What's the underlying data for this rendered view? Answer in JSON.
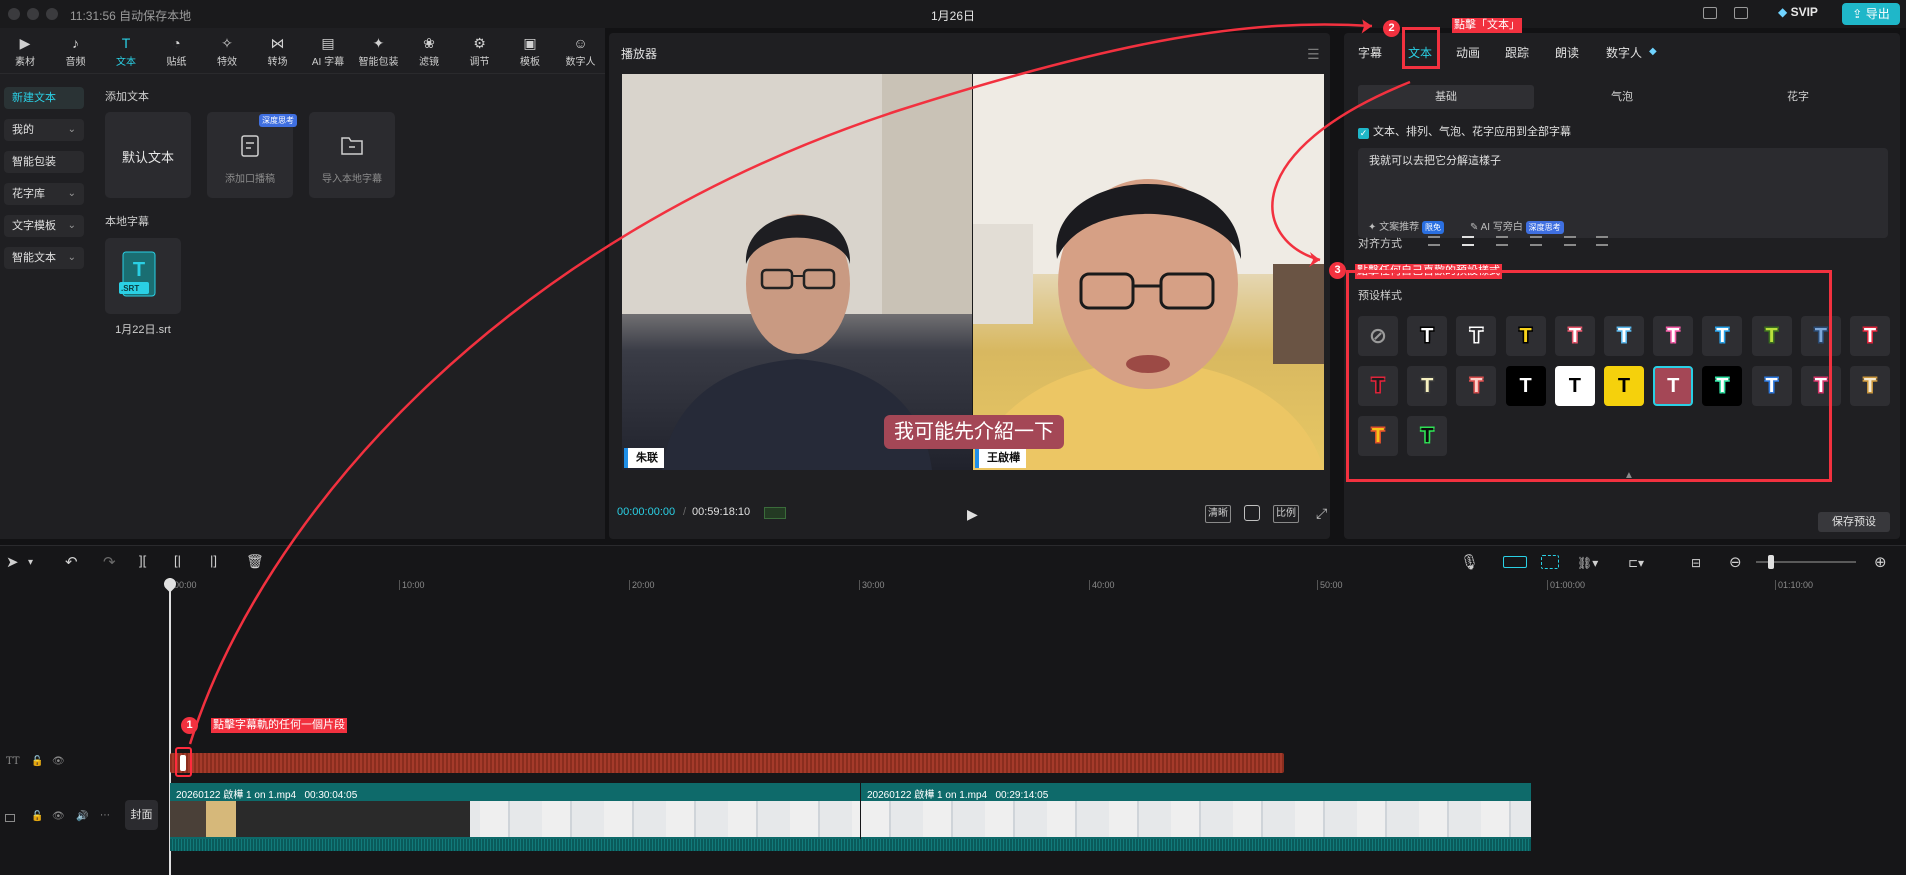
{
  "window": {
    "save_status": "11:31:56 自动保存本地",
    "project_title": "1月26日",
    "svip_label": "SVIP",
    "export_label": "导出"
  },
  "toolbar": {
    "items": [
      {
        "label": "素材",
        "icon": "media-icon"
      },
      {
        "label": "音频",
        "icon": "audio-icon"
      },
      {
        "label": "文本",
        "icon": "text-icon"
      },
      {
        "label": "贴纸",
        "icon": "sticker-icon"
      },
      {
        "label": "特效",
        "icon": "effects-icon"
      },
      {
        "label": "转场",
        "icon": "transition-icon"
      },
      {
        "label": "AI 字幕",
        "icon": "ai-subtitle-icon"
      },
      {
        "label": "智能包装",
        "icon": "smart-pack-icon"
      },
      {
        "label": "滤镜",
        "icon": "filter-icon"
      },
      {
        "label": "调节",
        "icon": "adjust-icon"
      },
      {
        "label": "模板",
        "icon": "template-icon"
      },
      {
        "label": "数字人",
        "icon": "digital-human-icon"
      }
    ],
    "active": "文本"
  },
  "sidebar": {
    "items": [
      {
        "label": "新建文本"
      },
      {
        "label": "我的"
      },
      {
        "label": "智能包装"
      },
      {
        "label": "花字库"
      },
      {
        "label": "文字模板"
      },
      {
        "label": "智能文本"
      }
    ]
  },
  "text_panel": {
    "add_text_heading": "添加文本",
    "default_text_label": "默认文本",
    "add_voiceover_label": "添加口播稿",
    "deep_badge": "深度思考",
    "import_local_label": "导入本地字幕",
    "local_subtitles_heading": "本地字幕",
    "srt_file_name": "1月22日.srt",
    "srt_badge": ".SRT"
  },
  "player": {
    "title": "播放器",
    "left_name": "朱联",
    "right_name": "王啟樺",
    "subtitle": "我可能先介紹一下",
    "current_time": "00:00:00:00",
    "duration": "00:59:18:10",
    "ctrl_clarity": "清晰",
    "ctrl_ratio": "比例"
  },
  "inspector": {
    "tabs": [
      {
        "label": "字幕"
      },
      {
        "label": "文本"
      },
      {
        "label": "动画"
      },
      {
        "label": "跟踪"
      },
      {
        "label": "朗读"
      },
      {
        "label": "数字人"
      }
    ],
    "active_tab": "文本",
    "subtabs": [
      {
        "label": "基础"
      },
      {
        "label": "气泡"
      },
      {
        "label": "花字"
      }
    ],
    "apply_all_label": "文本、排列、气泡、花字应用到全部字幕",
    "apply_all_checked": true,
    "text_value": "我就可以去把它分解這樣子",
    "copy_suggest_label": "文案推荐",
    "limited_free_badge": "限免",
    "ai_write_label": "AI 写旁白",
    "ai_deep_badge": "深度思考",
    "align_label": "对齐方式",
    "preset_label": "预设样式",
    "presets_row1": [
      {
        "fg": "none"
      },
      {
        "fg": "#ffffff",
        "bg": "#2e2e32",
        "stroke": "#000000"
      },
      {
        "fg": "#2e2e32",
        "bg": "#2e2e32",
        "stroke": "#ffffff"
      },
      {
        "fg": "#f7d21a",
        "bg": "#2e2e32",
        "stroke": "#000000"
      },
      {
        "fg": "#ffffff",
        "bg": "#2e2e32",
        "stroke": "#e6556b"
      },
      {
        "fg": "#ffffff",
        "bg": "#2e2e32",
        "stroke": "#59b6ea"
      },
      {
        "fg": "#ffffff",
        "bg": "#2e2e32",
        "stroke": "#f25aa6"
      },
      {
        "fg": "#ffffff",
        "bg": "#2e2e32",
        "stroke": "#27a3ea"
      },
      {
        "fg": "#b9e03c",
        "bg": "#2e2e32",
        "stroke": "#3b6f1f"
      },
      {
        "fg": "#7fa8d8",
        "bg": "#2e2e32",
        "stroke": "#2a4a72"
      },
      {
        "fg": "#ffffff",
        "bg": "#2e2e32",
        "stroke": "#e0243b"
      }
    ],
    "presets_row2": [
      {
        "fg": "#1c1c1c",
        "bg": "#2e2e32",
        "stroke": "#e0243b"
      },
      {
        "fg": "#f5f0c0",
        "bg": "#2e2e32",
        "stroke": "#3a3a3a"
      },
      {
        "fg": "#ffd0c8",
        "bg": "#2e2e32",
        "stroke": "#d64c4c"
      },
      {
        "fg": "#ffffff",
        "bg": "#000000",
        "stroke": "#000000"
      },
      {
        "fg": "#000000",
        "bg": "#ffffff",
        "stroke": "#ffffff"
      },
      {
        "fg": "#000000",
        "bg": "#f5d10c",
        "stroke": "#f5d10c"
      },
      {
        "fg": "#ffffff",
        "bg": "#a44756",
        "stroke": "#a44756",
        "selected": true
      },
      {
        "fg": "#ffffff",
        "bg": "#000000",
        "stroke": "#2ee0a2"
      },
      {
        "fg": "#ffffff",
        "bg": "#2e2e32",
        "stroke": "#2d79e0"
      },
      {
        "fg": "#ffffff",
        "bg": "#2e2e32",
        "stroke": "#d6356a"
      },
      {
        "fg": "#f6ead0",
        "bg": "#2e2e32",
        "stroke": "#c9953b"
      }
    ],
    "presets_row3": [
      {
        "fg": "#f7c21a",
        "bg": "#2e2e32",
        "stroke": "#e0502a"
      },
      {
        "fg": "#0c0c0c",
        "bg": "#2e2e32",
        "stroke": "#2ee054"
      }
    ],
    "save_preset_label": "保存预设"
  },
  "timeline": {
    "ticks": [
      "00:00",
      "10:00",
      "20:00",
      "30:00",
      "40:00",
      "50:00",
      "01:00:00",
      "01:10:00"
    ],
    "clip1_label": "20260122 啟樺 1 on 1.mp4",
    "clip1_duration": "00:30:04:05",
    "clip2_label": "20260122 啟樺 1 on 1.mp4",
    "clip2_duration": "00:29:14:05",
    "cover_label": "封面",
    "subtitle_track_label": "TT"
  },
  "annotations": {
    "step1_num": "1",
    "step1_text": "點擊字幕軌的任何一個片段",
    "step2_num": "2",
    "step2_text": "點擊「文本」",
    "step3_num": "3",
    "step3_text": "點擊任何自己喜歡的預設樣式",
    "color": "#f2313f"
  },
  "colors": {
    "accent": "#2ad0e5",
    "export": "#1fb7c9",
    "subtitle_bg": "#a44756",
    "clip_track": "#0e6a6a",
    "subtitle_track": "#a53a2a"
  }
}
